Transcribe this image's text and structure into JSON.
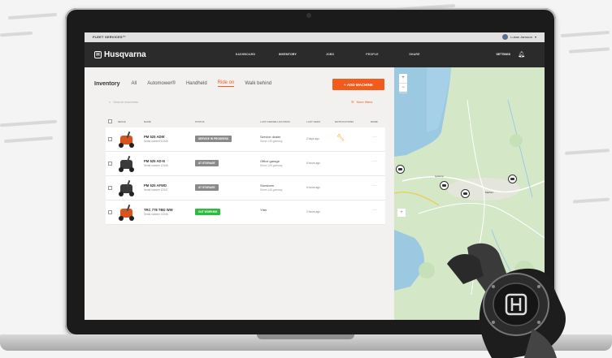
{
  "topbar": {
    "brand": "FLEET SERVICES™",
    "user": "Lukas Jansson"
  },
  "navbar": {
    "logo": "Husqvarna",
    "items": [
      "DASHBOARD",
      "INVENTORY",
      "JOBS",
      "PEOPLE",
      "SHARE"
    ],
    "active": "INVENTORY",
    "settings": "SETTINGS"
  },
  "inventory": {
    "title": "Inventory",
    "tabs": [
      "All",
      "Automower®",
      "Handheld",
      "Ride on",
      "Walk behind"
    ],
    "active_tab": "Ride on",
    "add_button": "+ ADD MACHINE",
    "search_placeholder": "Search machines",
    "filters": "More filters",
    "columns": [
      "IMAGE",
      "NAME",
      "STATUS",
      "LAST KNOWN LOCATION",
      "LAST SEEN",
      "NOTIFICATIONS",
      "MORE"
    ],
    "rows": [
      {
        "model": "PM 525 ADW",
        "serial": "Serial number 12345",
        "status": "SERVICE IN PROGRESS",
        "status_color": "#8a8a8a",
        "location": "Service dealer",
        "location_sub": "Street 145 gateway",
        "last_seen": "2 days ago",
        "notification": "wrench-icon",
        "thumb_color": "#d9531e"
      },
      {
        "model": "PM 525 AD-N",
        "serial": "Serial number 12346",
        "status": "AT STORAGE",
        "status_color": "#8a8a8a",
        "location": "Office garage",
        "location_sub": "Street 145 gateway",
        "last_seen": "6 hours ago",
        "notification": "",
        "thumb_color": "#3a3a3a"
      },
      {
        "model": "PM 525 AFWD",
        "serial": "Serial number 12347",
        "status": "AT STORAGE",
        "status_color": "#8a8a8a",
        "location": "Storstorm",
        "location_sub": "Street 145 gateway",
        "last_seen": "6 hours ago",
        "notification": "",
        "thumb_color": "#3a3a3a"
      },
      {
        "model": "TRC 778 TBD WW",
        "serial": "Serial number 12348",
        "status": "OUT WORKING",
        "status_color": "#2dbd3c",
        "location": "Ytter",
        "location_sub": "",
        "last_seen": "2 hours ago",
        "notification": "",
        "thumb_color": "#d9531e"
      }
    ]
  },
  "map": {
    "zoom_in": "+",
    "zoom_out": "−",
    "places": [
      "Ljustorp",
      "Matfors"
    ]
  }
}
